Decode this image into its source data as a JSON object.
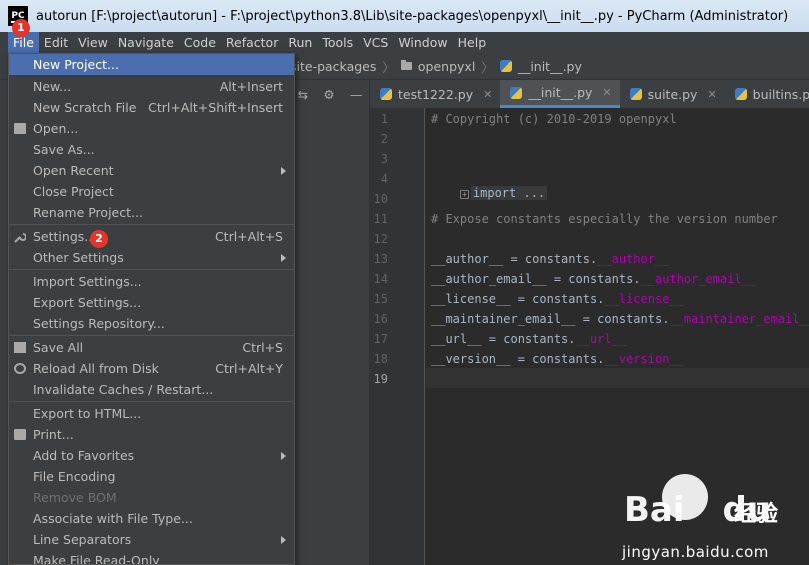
{
  "window": {
    "title": "autorun [F:\\project\\autorun] - F:\\project\\python3.8\\Lib\\site-packages\\openpyxl\\__init__.py - PyCharm (Administrator)",
    "logo": "PC"
  },
  "menubar": [
    "File",
    "Edit",
    "View",
    "Navigate",
    "Code",
    "Refactor",
    "Run",
    "Tools",
    "VCS",
    "Window",
    "Help"
  ],
  "breadcrumb": [
    "site-packages",
    "openpyxl",
    "__init__.py"
  ],
  "tabs": [
    {
      "label": "test1222.py",
      "active": false
    },
    {
      "label": "__init__.py",
      "active": true
    },
    {
      "label": "suite.py",
      "active": false
    },
    {
      "label": "builtins.py",
      "active": false
    }
  ],
  "file_menu": [
    {
      "label": "New Project...",
      "shortcut": "",
      "selected": true
    },
    {
      "label": "New...",
      "shortcut": "Alt+Insert"
    },
    {
      "label": "New Scratch File",
      "shortcut": "Ctrl+Alt+Shift+Insert"
    },
    {
      "label": "Open...",
      "shortcut": "",
      "icon": "folder-open-icon"
    },
    {
      "label": "Save As...",
      "shortcut": ""
    },
    {
      "label": "Open Recent",
      "shortcut": "",
      "submenu": true
    },
    {
      "label": "Close Project",
      "shortcut": ""
    },
    {
      "label": "Rename Project...",
      "shortcut": ""
    },
    {
      "label": "Settings...",
      "shortcut": "Ctrl+Alt+S",
      "icon": "wrench-icon"
    },
    {
      "label": "Other Settings",
      "shortcut": "",
      "submenu": true
    },
    {
      "label": "Import Settings...",
      "shortcut": ""
    },
    {
      "label": "Export Settings...",
      "shortcut": ""
    },
    {
      "label": "Settings Repository...",
      "shortcut": ""
    },
    {
      "label": "Save All",
      "shortcut": "Ctrl+S",
      "icon": "save-icon"
    },
    {
      "label": "Reload All from Disk",
      "shortcut": "Ctrl+Alt+Y",
      "icon": "reload-icon"
    },
    {
      "label": "Invalidate Caches / Restart...",
      "shortcut": ""
    },
    {
      "label": "Export to HTML...",
      "shortcut": ""
    },
    {
      "label": "Print...",
      "shortcut": "",
      "icon": "print-icon"
    },
    {
      "label": "Add to Favorites",
      "shortcut": "",
      "submenu": true
    },
    {
      "label": "File Encoding",
      "shortcut": ""
    },
    {
      "label": "Remove BOM",
      "shortcut": "",
      "disabled": true
    },
    {
      "label": "Associate with File Type...",
      "shortcut": ""
    },
    {
      "label": "Line Separators",
      "shortcut": "",
      "submenu": true
    },
    {
      "label": "Make File Read-Only",
      "shortcut": ""
    }
  ],
  "badges": [
    "1",
    "2"
  ],
  "editor": {
    "line_numbers": [
      "1",
      "2",
      "3",
      "4",
      "10",
      "11",
      "12",
      "13",
      "14",
      "15",
      "16",
      "17",
      "18",
      "19"
    ],
    "lines": [
      "# Copyright (c) 2010-2019 openpyxl",
      "",
      "",
      "import ...",
      "",
      "# Expose constants especially the version number",
      "",
      "__author__ = constants.__author__",
      "__author_email__ = constants.__author_email__",
      "__license__ = constants.__license__",
      "__maintainer_email__ = constants.__maintainer_email__",
      "__url__ = constants.__url__",
      "__version__ = constants.__version__",
      ""
    ]
  },
  "watermark": {
    "brand": "Bai",
    "brand2": "du",
    "product": "经验",
    "url": "jingyan.baidu.com"
  },
  "colors": {
    "menu_bg": "#3c3f41",
    "selection": "#4b6eaf",
    "editor_bg": "#2b2b2b",
    "badge": "#e3352b",
    "dunder": "#b200b2"
  }
}
